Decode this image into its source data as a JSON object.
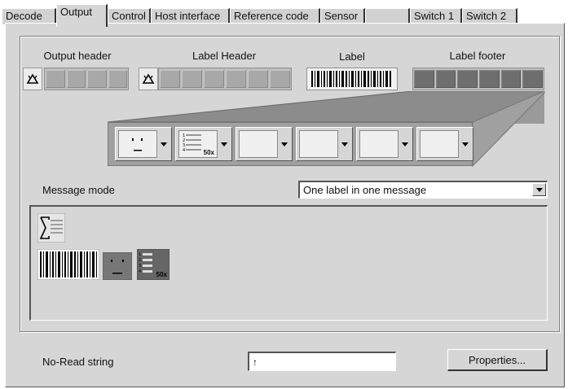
{
  "tabs": [
    {
      "label": "Decode"
    },
    {
      "label": "Output"
    },
    {
      "label": "Control"
    },
    {
      "label": "Host interface"
    },
    {
      "label": "Reference code"
    },
    {
      "label": "Sensor"
    },
    {
      "label": ""
    },
    {
      "label": "Switch 1"
    },
    {
      "label": "Switch 2"
    }
  ],
  "active_tab": "Output",
  "sections": {
    "output_header": "Output header",
    "label_header": "Label Header",
    "label": "Label",
    "label_footer": "Label footer"
  },
  "counter_icon_text": "50x",
  "message_mode": {
    "label": "Message mode",
    "value": "One label in one message"
  },
  "no_read": {
    "label": "No-Read string",
    "value": "↑"
  },
  "properties_button": {
    "label": "Properties..."
  },
  "colors": {
    "panel": "#d6d6d6",
    "cell": "#a8a8a8",
    "footer_cell": "#6e6e6e"
  },
  "icons": {
    "recycle": "recycle-icon",
    "barcode": "barcode-icon",
    "face": "face-icon",
    "list_counter": "list-counter-icon",
    "sum": "sum-icon"
  }
}
